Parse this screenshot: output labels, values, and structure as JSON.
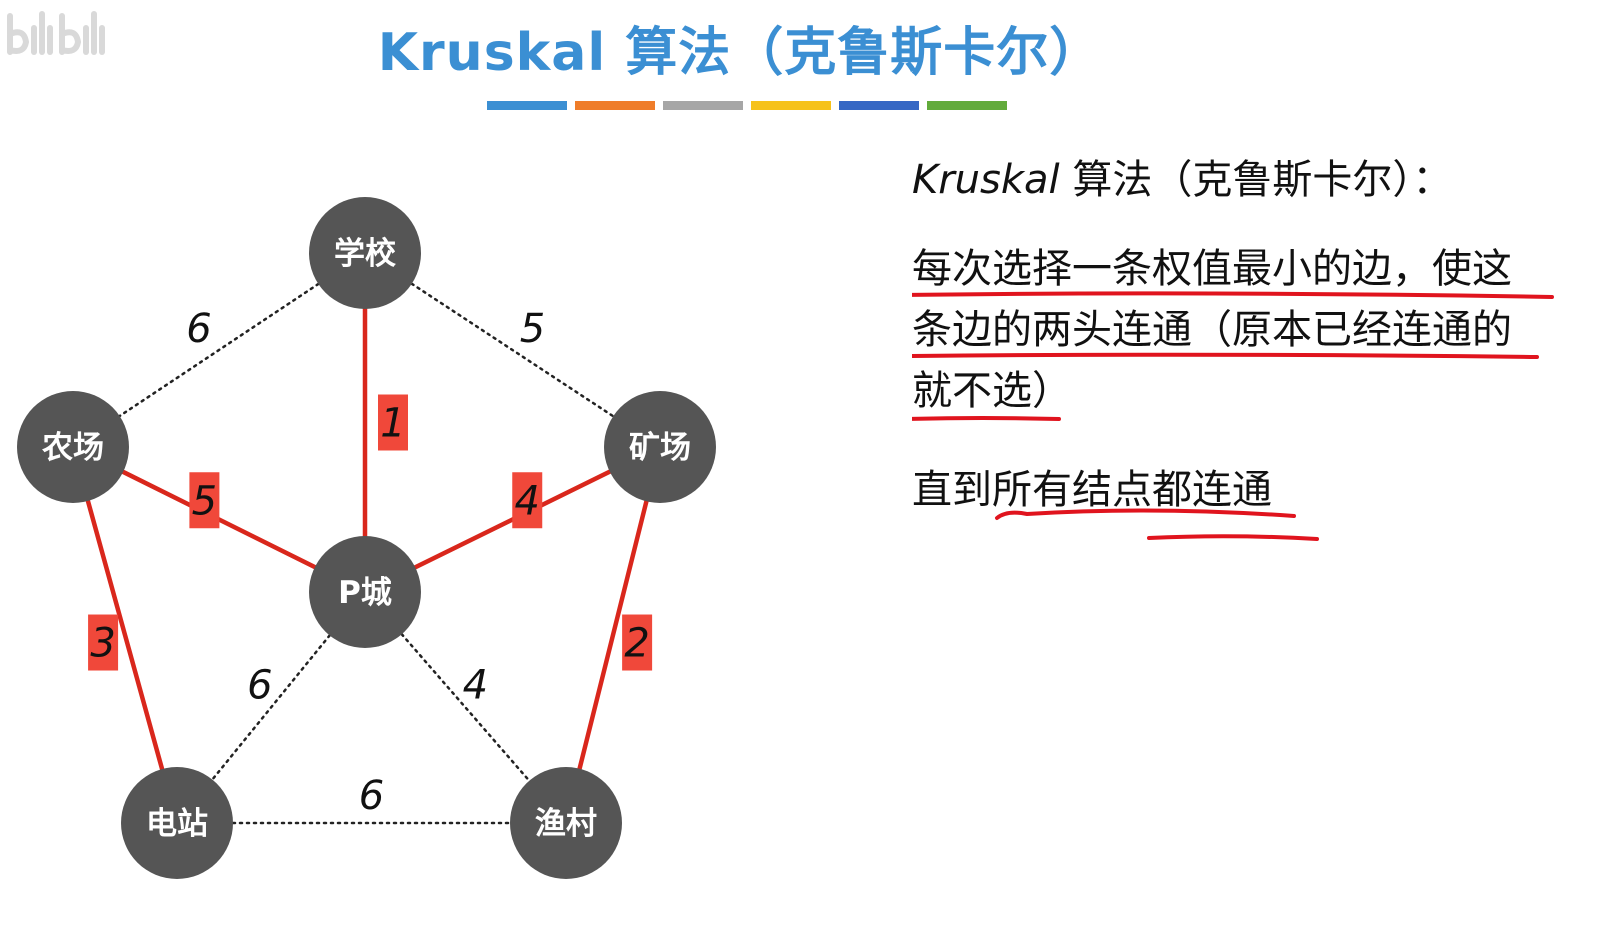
{
  "logo": {
    "icon": "bilibili-icon"
  },
  "title": {
    "text": "Kruskal 算法（克鲁斯卡尔）"
  },
  "title_bar_colors": [
    "#3b8fd3",
    "#ef7d2a",
    "#a6a6a6",
    "#f6c21b",
    "#3567c4",
    "#62ab3b"
  ],
  "colors": {
    "title": "#3b8fd3",
    "node_fill": "#555555",
    "node_text": "#ffffff",
    "selected_edge": "#d9271c",
    "selected_label_bg": "#f0483a",
    "dotted_edge": "#222222",
    "underline": "#e0141e"
  },
  "graph": {
    "nodes": [
      {
        "id": "school",
        "label": "学校"
      },
      {
        "id": "farm",
        "label": "农场"
      },
      {
        "id": "mine",
        "label": "矿场"
      },
      {
        "id": "pcity",
        "label": "P城"
      },
      {
        "id": "power",
        "label": "电站"
      },
      {
        "id": "fish",
        "label": "渔村"
      }
    ],
    "edges": [
      {
        "from": "school",
        "to": "farm",
        "weight": "6",
        "selected": false
      },
      {
        "from": "school",
        "to": "mine",
        "weight": "5",
        "selected": false
      },
      {
        "from": "school",
        "to": "pcity",
        "weight": "1",
        "selected": true
      },
      {
        "from": "farm",
        "to": "pcity",
        "weight": "5",
        "selected": true
      },
      {
        "from": "mine",
        "to": "pcity",
        "weight": "4",
        "selected": true
      },
      {
        "from": "farm",
        "to": "power",
        "weight": "3",
        "selected": true
      },
      {
        "from": "mine",
        "to": "fish",
        "weight": "2",
        "selected": true
      },
      {
        "from": "pcity",
        "to": "power",
        "weight": "6",
        "selected": false
      },
      {
        "from": "pcity",
        "to": "fish",
        "weight": "4",
        "selected": false
      },
      {
        "from": "power",
        "to": "fish",
        "weight": "6",
        "selected": false
      }
    ]
  },
  "notes": {
    "title_keyword": "Kruskal",
    "title_rest": " 算法（克鲁斯卡尔）：",
    "desc_line1": "每次选择一条权值最小的边，使这",
    "desc_line2": "条边的两头连通（原本已经连通的",
    "desc_line3": "就不选）",
    "stop_prefix": "直到",
    "stop_underlined": "所有结点都连通"
  }
}
